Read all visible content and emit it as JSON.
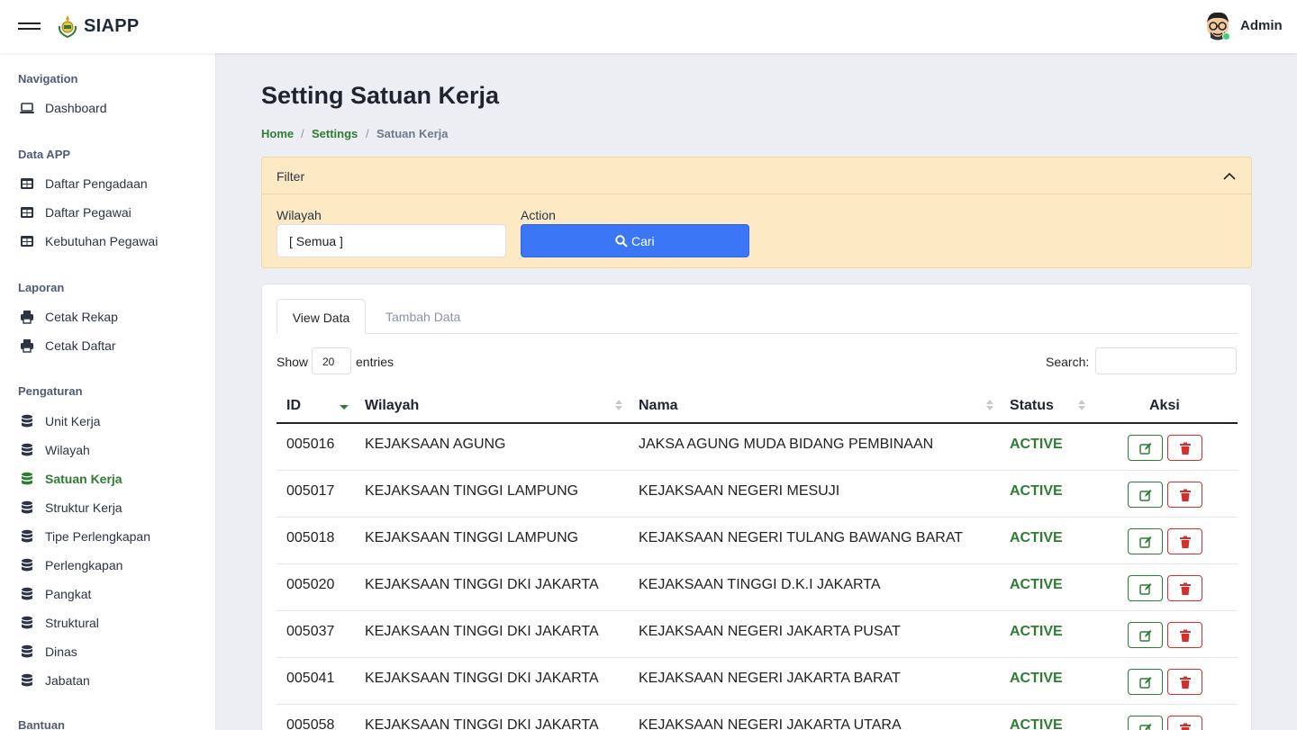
{
  "header": {
    "brand": "SIAPP",
    "user": "Admin"
  },
  "sidebar": {
    "sections": [
      {
        "title": "Navigation"
      },
      {
        "title": "Data APP"
      },
      {
        "title": "Laporan"
      },
      {
        "title": "Pengaturan"
      },
      {
        "title": "Bantuan"
      }
    ],
    "items": [
      {
        "label": "Dashboard",
        "icon": "laptop-icon"
      },
      {
        "label": "Daftar Pengadaan",
        "icon": "table-icon"
      },
      {
        "label": "Daftar Pegawai",
        "icon": "table-icon"
      },
      {
        "label": "Kebutuhan Pegawai",
        "icon": "table-icon"
      },
      {
        "label": "Cetak Rekap",
        "icon": "printer-icon"
      },
      {
        "label": "Cetak Daftar",
        "icon": "printer-icon"
      },
      {
        "label": "Unit Kerja",
        "icon": "database-icon"
      },
      {
        "label": "Wilayah",
        "icon": "database-icon"
      },
      {
        "label": "Satuan Kerja",
        "icon": "database-icon",
        "active": true
      },
      {
        "label": "Struktur Kerja",
        "icon": "database-icon"
      },
      {
        "label": "Tipe Perlengkapan",
        "icon": "database-icon"
      },
      {
        "label": "Perlengkapan",
        "icon": "database-icon"
      },
      {
        "label": "Pangkat",
        "icon": "database-icon"
      },
      {
        "label": "Struktural",
        "icon": "database-icon"
      },
      {
        "label": "Dinas",
        "icon": "database-icon"
      },
      {
        "label": "Jabatan",
        "icon": "database-icon"
      }
    ]
  },
  "page": {
    "title": "Setting Satuan Kerja",
    "breadcrumb": [
      "Home",
      "Settings",
      "Satuan Kerja"
    ],
    "breadcrumb_sep": "/"
  },
  "filter": {
    "title": "Filter",
    "wilayah_label": "Wilayah",
    "wilayah_value": "[ Semua ]",
    "action_label": "Action",
    "search_button": "Cari"
  },
  "tabs": [
    "View Data",
    "Tambah Data"
  ],
  "table_controls": {
    "show": "Show",
    "entries_value": "20",
    "entries": "entries",
    "search_label": "Search:",
    "search_value": ""
  },
  "table": {
    "columns": [
      "ID",
      "Wilayah",
      "Nama",
      "Status",
      "Aksi"
    ],
    "rows": [
      {
        "id": "005016",
        "wilayah": "KEJAKSAAN AGUNG",
        "nama": "JAKSA AGUNG MUDA BIDANG PEMBINAAN",
        "status": "ACTIVE"
      },
      {
        "id": "005017",
        "wilayah": "KEJAKSAAN TINGGI LAMPUNG",
        "nama": "KEJAKSAAN NEGERI MESUJI",
        "status": "ACTIVE"
      },
      {
        "id": "005018",
        "wilayah": "KEJAKSAAN TINGGI LAMPUNG",
        "nama": "KEJAKSAAN NEGERI TULANG BAWANG BARAT",
        "status": "ACTIVE"
      },
      {
        "id": "005020",
        "wilayah": "KEJAKSAAN TINGGI DKI JAKARTA",
        "nama": "KEJAKSAAN TINGGI D.K.I JAKARTA",
        "status": "ACTIVE"
      },
      {
        "id": "005037",
        "wilayah": "KEJAKSAAN TINGGI DKI JAKARTA",
        "nama": "KEJAKSAAN NEGERI JAKARTA PUSAT",
        "status": "ACTIVE"
      },
      {
        "id": "005041",
        "wilayah": "KEJAKSAAN TINGGI DKI JAKARTA",
        "nama": "KEJAKSAAN NEGERI JAKARTA BARAT",
        "status": "ACTIVE"
      },
      {
        "id": "005058",
        "wilayah": "KEJAKSAAN TINGGI DKI JAKARTA",
        "nama": "KEJAKSAAN NEGERI JAKARTA UTARA",
        "status": "ACTIVE"
      }
    ]
  },
  "colors": {
    "accent_green": "#2e7d32",
    "primary_blue": "#3b76f6",
    "danger_red": "#d32f2f",
    "filter_bg": "#fde9c4"
  }
}
